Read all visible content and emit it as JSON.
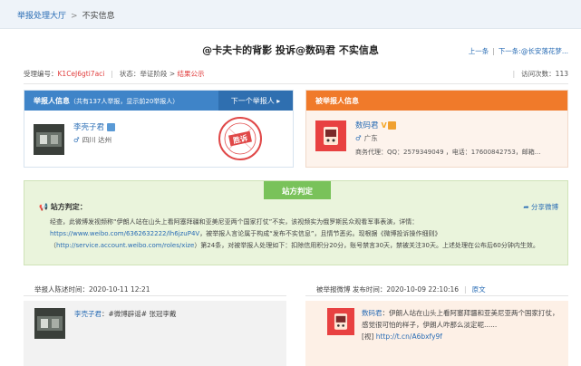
{
  "breadcrumb": {
    "home": "举报处理大厅",
    "separator": ">",
    "current": "不实信息"
  },
  "title": "@卡夫卡的背影 投诉@数码君 不实信息",
  "nav": {
    "prev": "上一条",
    "next": "下一条:@长安落花梦...",
    "separator": "|"
  },
  "meta": {
    "case_label": "受理编号：",
    "case_id": "K1CeJ6gti7aci",
    "status_label": "状态：举证阶段 ",
    "status_arrow": "> ",
    "status_value": "结果公示",
    "visits": "访问次数：113"
  },
  "reporter": {
    "header": "举报人信息",
    "header_sub": "（共有137人举报，显示前20举报人）",
    "next_label": "下一个举报人",
    "next_icon": "triangle-right-icon",
    "name": "李壳子君",
    "gender_icon": "male-icon",
    "location": "四川 达州",
    "stamp_text": "胜诉"
  },
  "reported": {
    "header": "被举报人信息",
    "name": "数码君",
    "gender_icon": "male-icon",
    "location": "广东",
    "contact": "商务代理：QQ：2579349049 ，电话：17600842753，邮箱..."
  },
  "verdict": {
    "tab": "站方判定",
    "label": "站方判定：",
    "share": "分享微博",
    "text_pre": "经查，此微博发视频称“伊朗人站在山头上看阿塞拜疆和亚美尼亚两个国家打仗”不实，该视频实为俄罗斯民众观看军事表演，详情：",
    "link1": "https://www.weibo.com/6362632222/lh6jzuP4V",
    "text_mid": "，被举报人言论属于构成“发布不实信息”，且情节恶劣。现根据《微博投诉操作细则》（",
    "link2": "http://service.account.weibo.com/roles/xize",
    "text_post": "）第24条，对被举报人处理如下：扣除信用积分20分，账号禁言30天，禁被关注30天。上述处理在公布后60分钟内生效。"
  },
  "left_section": {
    "head": "举报人陈述时间：2020-10-11 12:21",
    "name": "李壳子君",
    "text": "：#微博辟谣# 张冠李戴"
  },
  "right_section": {
    "head": "被举报微博 发布时间：2020-10-09 22:10:16",
    "separator": "|",
    "original": "原文",
    "name": "数码君",
    "text": "：伊朗人站在山头上看阿塞拜疆和亚美尼亚两个国家打仗，感觉很可怕的样子，伊朗人咋那么淡定呢......",
    "video_label": "[视]",
    "video_link": "http://t.cn/A6bxfy9f"
  }
}
